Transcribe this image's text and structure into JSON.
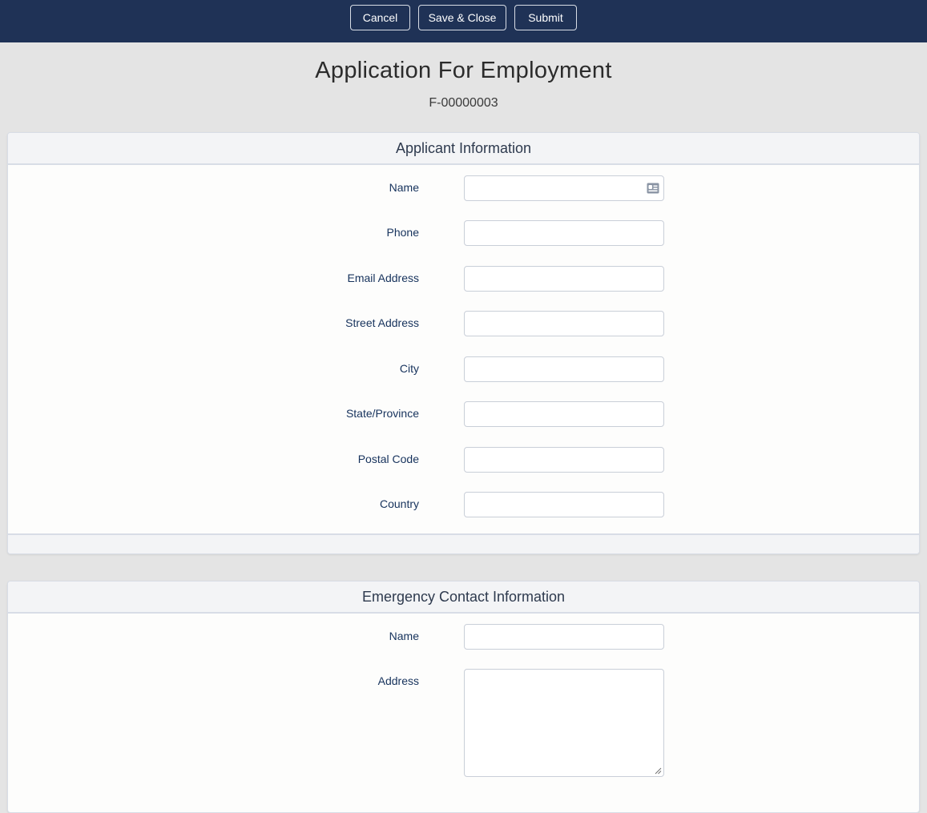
{
  "toolbar": {
    "cancel_label": "Cancel",
    "save_close_label": "Save & Close",
    "submit_label": "Submit"
  },
  "header": {
    "title": "Application For Employment",
    "record_id": "F-00000003"
  },
  "applicant_section": {
    "title": "Applicant Information",
    "fields": [
      {
        "label": "Name",
        "value": "",
        "icon": "contact-card-icon"
      },
      {
        "label": "Phone",
        "value": ""
      },
      {
        "label": "Email Address",
        "value": ""
      },
      {
        "label": "Street Address",
        "value": ""
      },
      {
        "label": "City",
        "value": ""
      },
      {
        "label": "State/Province",
        "value": ""
      },
      {
        "label": "Postal Code",
        "value": ""
      },
      {
        "label": "Country",
        "value": ""
      }
    ]
  },
  "emergency_section": {
    "title": "Emergency Contact Information",
    "fields": [
      {
        "label": "Name",
        "value": ""
      },
      {
        "label": "Address",
        "value": ""
      }
    ]
  },
  "colors": {
    "topbar": "#1f3256",
    "label_text": "#16325c",
    "page_background": "#e4e4e4"
  }
}
